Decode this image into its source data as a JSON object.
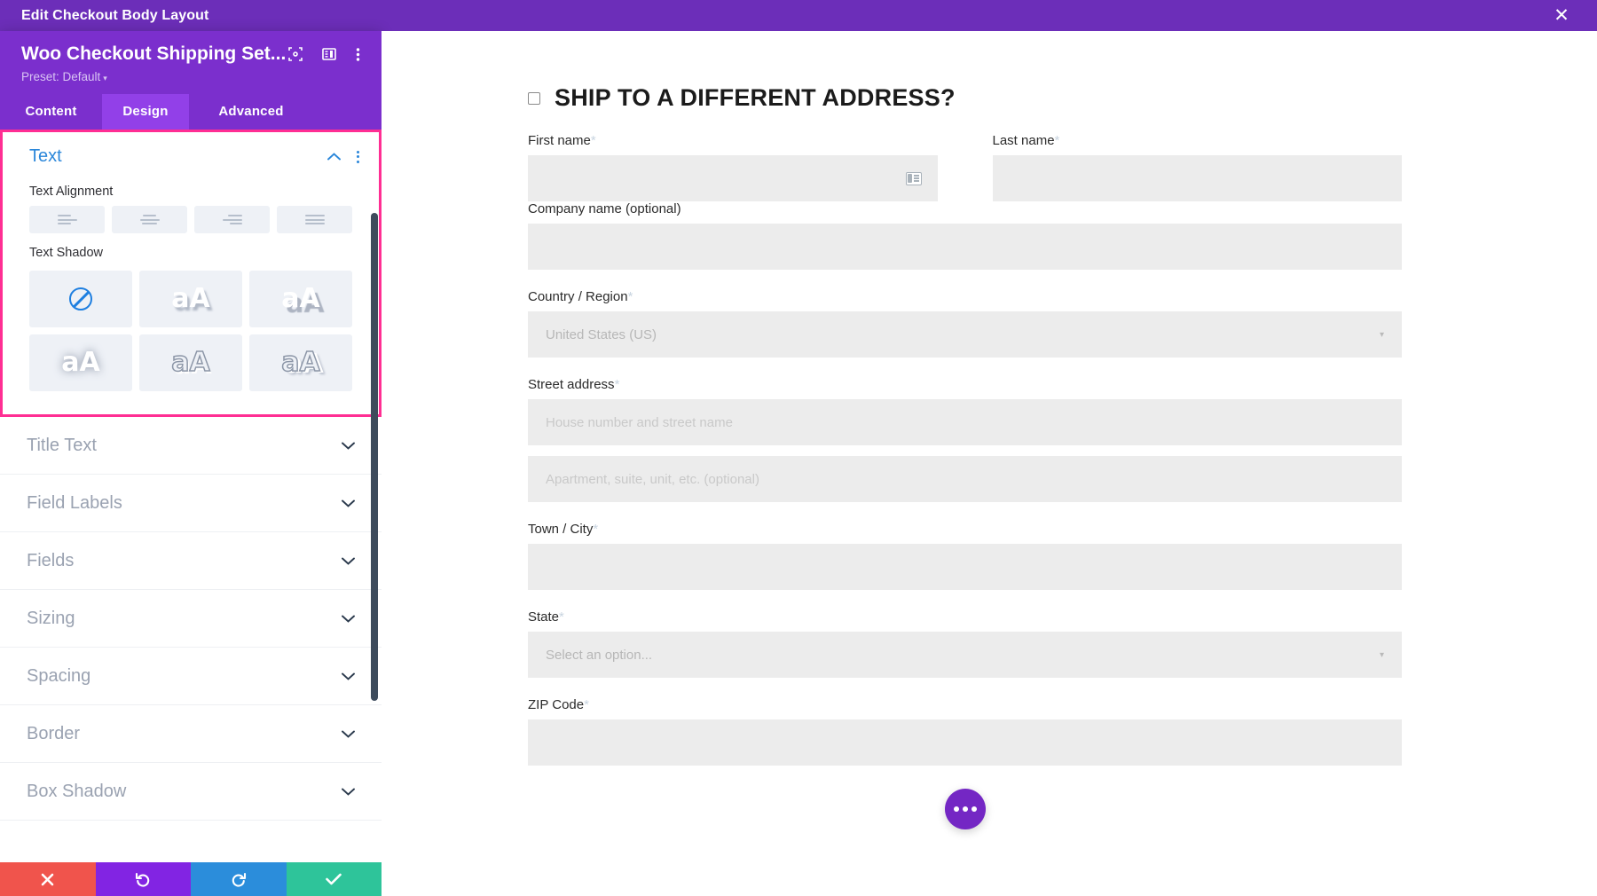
{
  "topbar": {
    "title": "Edit Checkout Body Layout",
    "close_label": "✕"
  },
  "panel": {
    "module_title": "Woo Checkout Shipping Set...",
    "preset_label": "Preset: Default",
    "preset_caret": "▾",
    "tabs": [
      {
        "label": "Content",
        "active": false
      },
      {
        "label": "Design",
        "active": true
      },
      {
        "label": "Advanced",
        "active": false
      }
    ],
    "active_group": {
      "name": "Text",
      "collapse_icon": "⌃",
      "text_alignment": {
        "label": "Text Alignment",
        "options": [
          "left",
          "center",
          "right",
          "justify"
        ]
      },
      "text_shadow": {
        "label": "Text Shadow",
        "presets": [
          "none",
          "drop-soft",
          "drop-hard",
          "glow",
          "outline",
          "outline-offset"
        ],
        "sample_text": "aA"
      }
    },
    "sections": [
      {
        "label": "Title Text"
      },
      {
        "label": "Field Labels"
      },
      {
        "label": "Fields"
      },
      {
        "label": "Sizing"
      },
      {
        "label": "Spacing"
      },
      {
        "label": "Border"
      },
      {
        "label": "Box Shadow"
      }
    ],
    "footer_buttons": [
      {
        "name": "discard",
        "glyph": "✖",
        "color": "#f0544c"
      },
      {
        "name": "undo",
        "glyph": "↺",
        "color": "#8224e3"
      },
      {
        "name": "redo",
        "glyph": "↻",
        "color": "#2b8ddb"
      },
      {
        "name": "save",
        "glyph": "✔",
        "color": "#2ec49a"
      }
    ]
  },
  "checkout": {
    "heading": "SHIP TO A DIFFERENT ADDRESS?",
    "required_mark": "*",
    "fields": {
      "first_name": {
        "label": "First name",
        "required": true,
        "value": ""
      },
      "last_name": {
        "label": "Last name",
        "required": true,
        "value": ""
      },
      "company": {
        "label": "Company name (optional)",
        "required": false,
        "value": ""
      },
      "country": {
        "label": "Country / Region",
        "required": true,
        "value": "United States (US)"
      },
      "street": {
        "label": "Street address",
        "required": true,
        "placeholder": "House number and street name"
      },
      "street2": {
        "label": "",
        "required": false,
        "placeholder": "Apartment, suite, unit, etc. (optional)"
      },
      "city": {
        "label": "Town / City",
        "required": true,
        "value": ""
      },
      "state": {
        "label": "State",
        "required": true,
        "value": "Select an option..."
      },
      "zip": {
        "label": "ZIP Code",
        "required": true,
        "value": ""
      }
    },
    "select_arrow": "▾"
  },
  "colors": {
    "brand_purple": "#7b2fcd",
    "topbar_purple": "#6c2eb9",
    "tab_active": "#9240e8",
    "highlight_pink": "#ff2e93",
    "group_blue": "#2b87da",
    "fab_purple": "#7427c4"
  }
}
